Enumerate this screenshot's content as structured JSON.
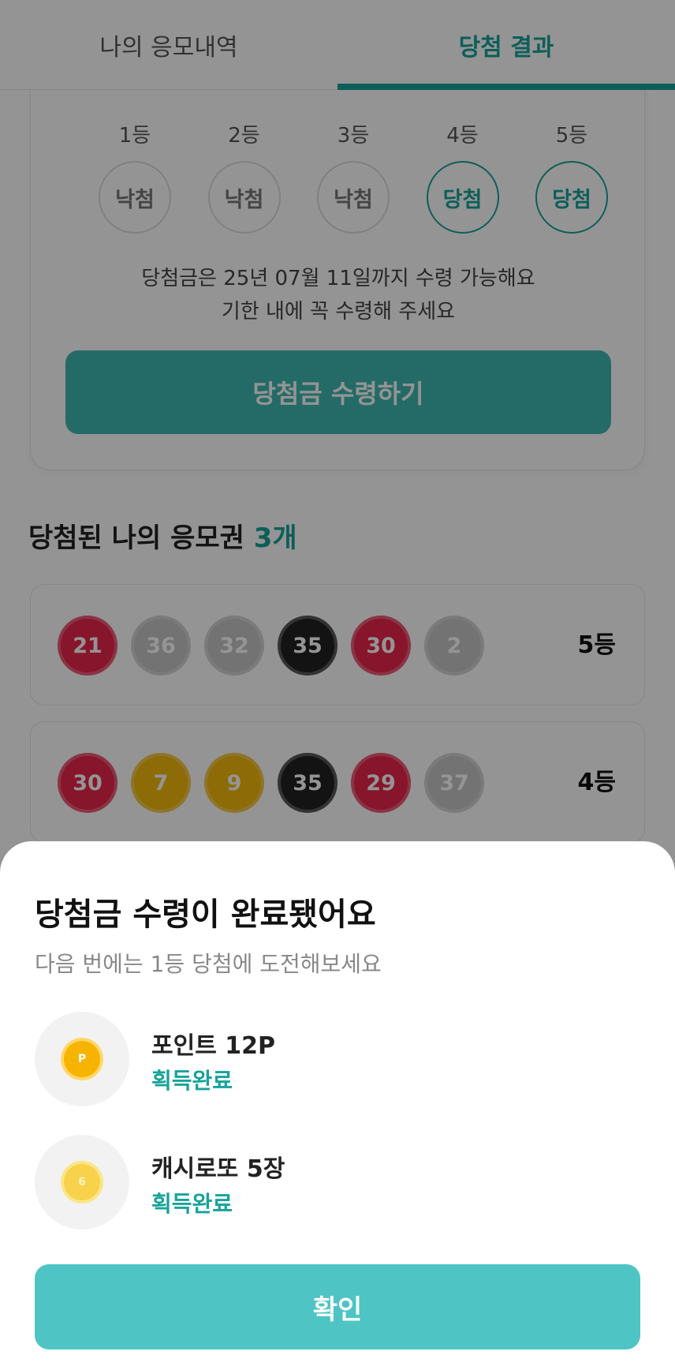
{
  "tabs": [
    {
      "label": "나의 응모내역",
      "active": false
    },
    {
      "label": "당첨 결과",
      "active": true
    }
  ],
  "ranks": [
    {
      "label": "1등",
      "status": "낙첨",
      "win": false
    },
    {
      "label": "2등",
      "status": "낙첨",
      "win": false
    },
    {
      "label": "3등",
      "status": "낙첨",
      "win": false
    },
    {
      "label": "4등",
      "status": "당첨",
      "win": true
    },
    {
      "label": "5등",
      "status": "당첨",
      "win": true
    }
  ],
  "notice": {
    "line1": "당첨금은 25년 07월 11일까지 수령 가능해요",
    "line2": "기한 내에 꼭 수령해 주세요"
  },
  "claim_button": "당첨금 수령하기",
  "winning_section": {
    "title": "당첨된 나의 응모권",
    "count": "3개"
  },
  "tickets": [
    {
      "numbers": [
        {
          "value": "21",
          "color": "red"
        },
        {
          "value": "36",
          "color": "gray"
        },
        {
          "value": "32",
          "color": "gray"
        },
        {
          "value": "35",
          "color": "black"
        },
        {
          "value": "30",
          "color": "red"
        },
        {
          "value": "2",
          "color": "gray"
        }
      ],
      "rank": "5등"
    },
    {
      "numbers": [
        {
          "value": "30",
          "color": "red"
        },
        {
          "value": "7",
          "color": "yellow"
        },
        {
          "value": "9",
          "color": "yellow"
        },
        {
          "value": "35",
          "color": "black"
        },
        {
          "value": "29",
          "color": "red"
        },
        {
          "value": "37",
          "color": "gray"
        }
      ],
      "rank": "4등"
    }
  ],
  "sheet": {
    "title": "당첨금 수령이 완료됐어요",
    "subtitle": "다음 번에는 1등 당첨에 도전해보세요",
    "rewards": [
      {
        "icon": "point-coin-icon",
        "coin_text": "P",
        "name": "포인트 12P",
        "status": "획득완료"
      },
      {
        "icon": "cash-lotto-coin-icon",
        "coin_text": "6",
        "name": "캐시로또 5장",
        "status": "획득완료"
      }
    ],
    "confirm_label": "확인"
  },
  "colors": {
    "accent": "#17a39a",
    "button": "#4ec4c5",
    "ball_red": "#e8254a",
    "ball_gray": "#c7c7c7",
    "ball_black": "#222222",
    "ball_yellow": "#f3b90d"
  }
}
